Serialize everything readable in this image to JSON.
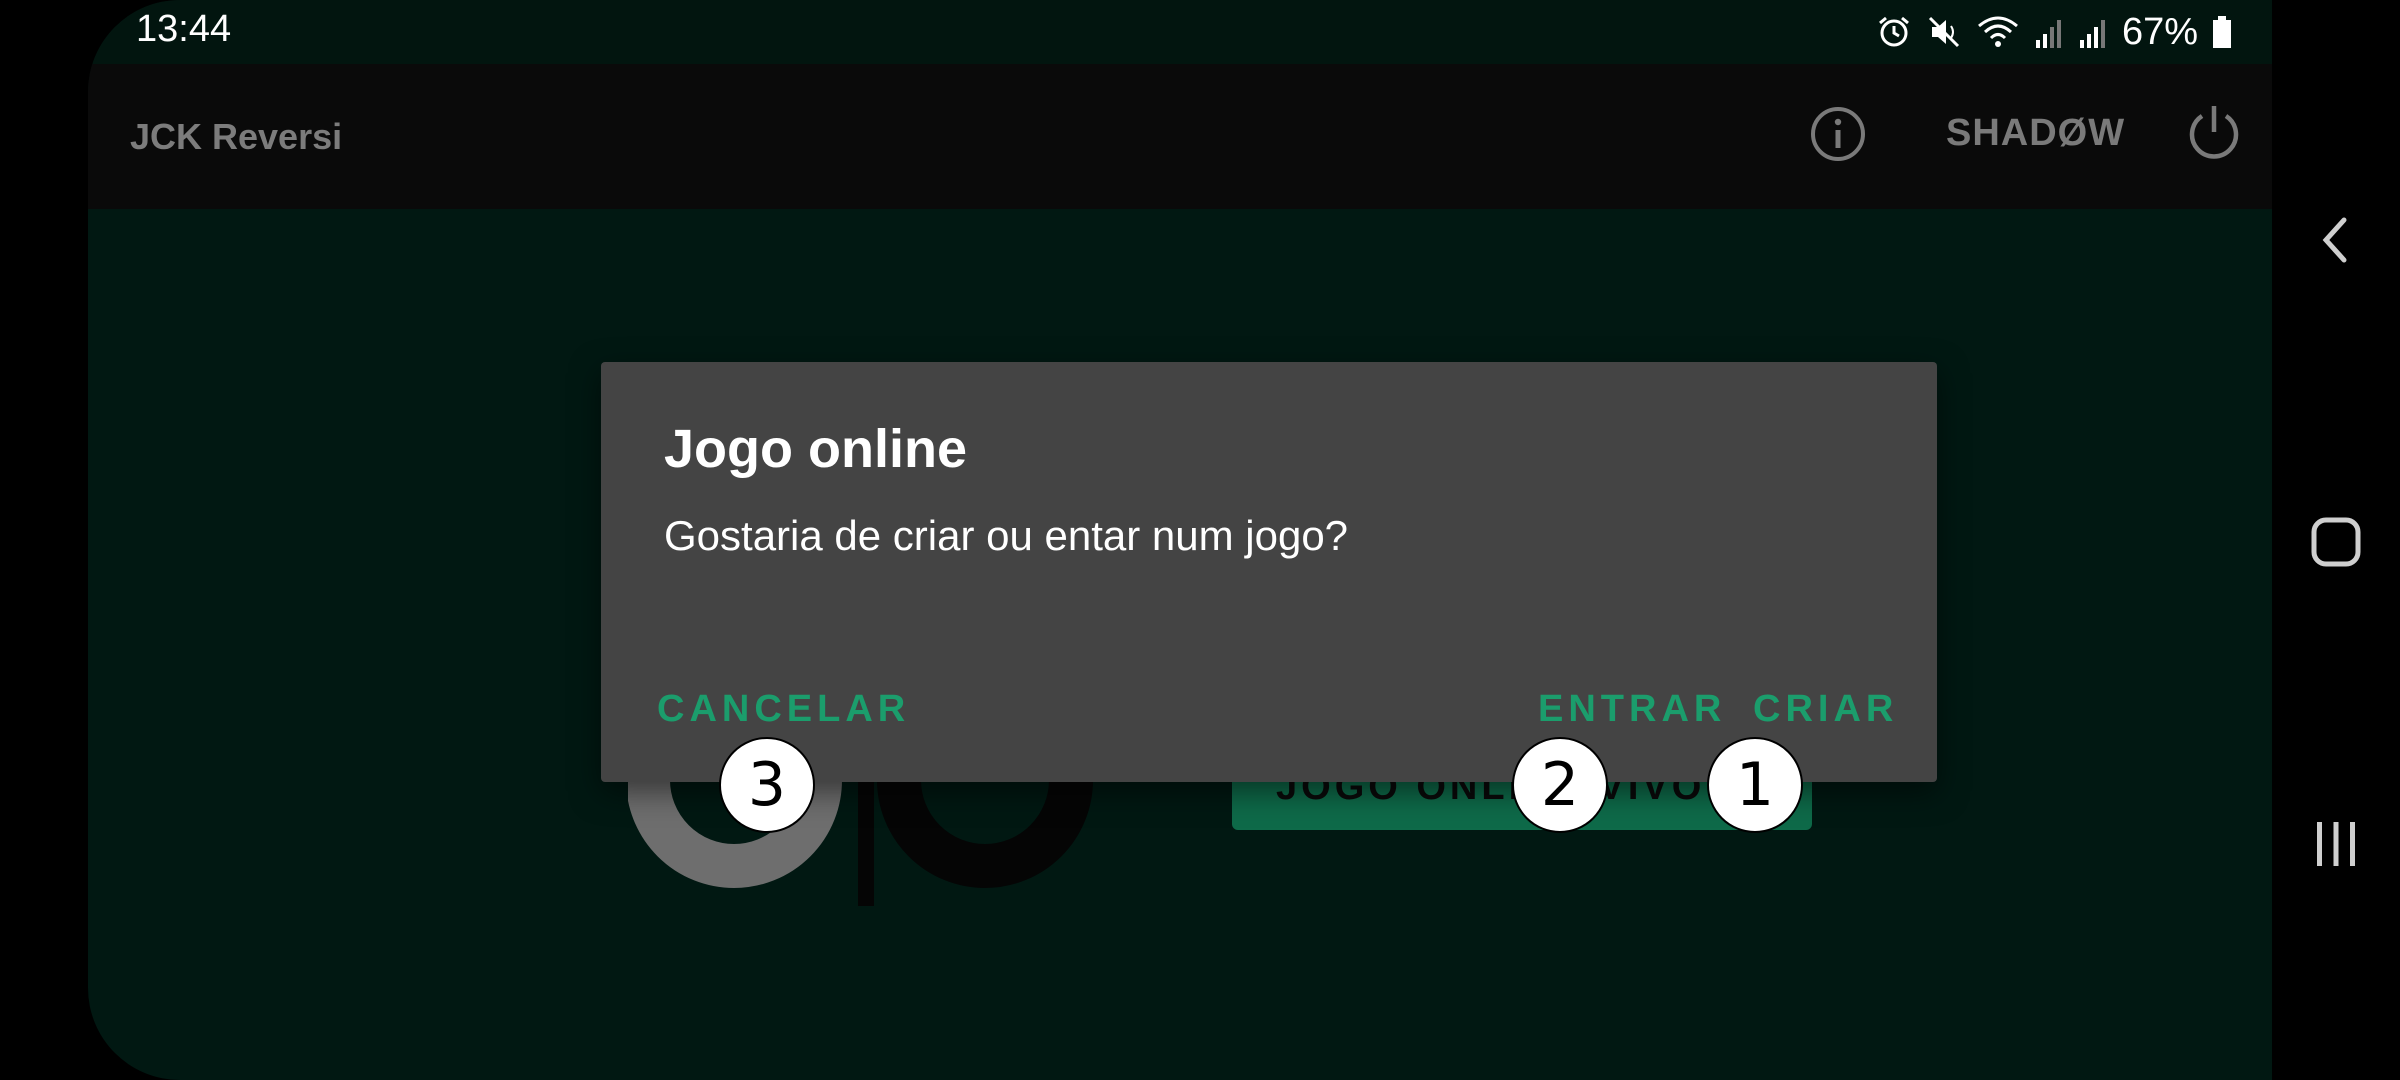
{
  "status_bar": {
    "time": "13:44",
    "battery": "67%",
    "icons": [
      "alarm-icon",
      "mute-icon",
      "wifi-icon",
      "signal-icon",
      "signal-icon",
      "battery-icon"
    ]
  },
  "toolbar": {
    "title": "JCK Reversi",
    "info_icon": "info-icon",
    "shadow_label": "SHADØW",
    "power_icon": "power-icon"
  },
  "background": {
    "online_button_label": "JOGO ONLINE VIVO"
  },
  "dialog": {
    "title": "Jogo online",
    "message": "Gostaria de criar ou entar num jogo?",
    "cancel_label": "CANCELAR",
    "enter_label": "ENTRAR",
    "create_label": "CRIAR"
  },
  "markers": {
    "create": "1",
    "enter": "2",
    "cancel": "3"
  },
  "colors": {
    "accent": "#1b9d6c",
    "dialog_bg": "#444444",
    "app_bg": "#011812",
    "toolbar_bg": "#0a0a0a"
  },
  "nav_bar": {
    "icons": [
      "back-icon",
      "home-icon",
      "recents-icon"
    ]
  }
}
